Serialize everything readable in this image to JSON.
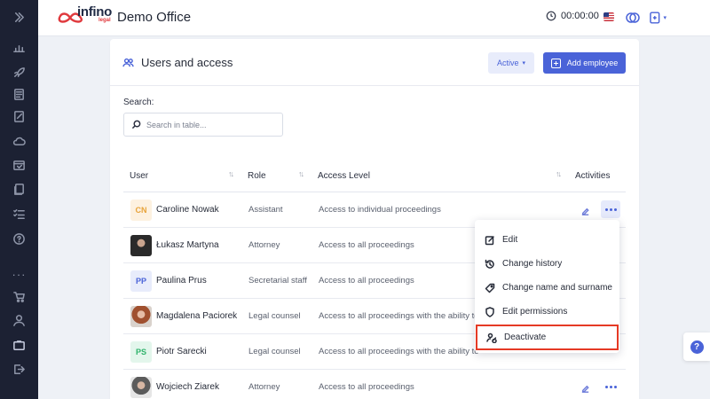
{
  "brand": {
    "logo_text": "infino",
    "logo_sub": "legal",
    "app_title": "Demo Office"
  },
  "topbar": {
    "timer": "00:00:00"
  },
  "card": {
    "title": "Users and access",
    "status_filter": "Active",
    "add_button": "Add employee",
    "search_label": "Search:",
    "search_placeholder": "Search in table..."
  },
  "table": {
    "headers": {
      "user": "User",
      "role": "Role",
      "access": "Access Level",
      "activities": "Activities"
    },
    "rows": [
      {
        "initials": "CN",
        "name": "Caroline Nowak",
        "role": "Assistant",
        "access": "Access to individual proceedings"
      },
      {
        "initials": "",
        "name": "Łukasz Martyna",
        "role": "Attorney",
        "access": "Access to all proceedings"
      },
      {
        "initials": "PP",
        "name": "Paulina Prus",
        "role": "Secretarial staff",
        "access": "Access to all proceedings"
      },
      {
        "initials": "",
        "name": "Magdalena Paciorek",
        "role": "Legal counsel",
        "access": "Access to all proceedings with the ability to"
      },
      {
        "initials": "PS",
        "name": "Piotr Sarecki",
        "role": "Legal counsel",
        "access": "Access to all proceedings with the ability to"
      },
      {
        "initials": "",
        "name": "Wojciech Ziarek",
        "role": "Attorney",
        "access": "Access to all proceedings"
      }
    ]
  },
  "menu": {
    "items": [
      {
        "label": "Edit",
        "icon": "edit-icon"
      },
      {
        "label": "Change history",
        "icon": "history-icon"
      },
      {
        "label": "Change name and surname",
        "icon": "tag-icon"
      },
      {
        "label": "Edit permissions",
        "icon": "shield-icon"
      },
      {
        "label": "Deactivate",
        "icon": "user-deactivate-icon"
      }
    ]
  },
  "help": {
    "label": "?"
  },
  "colors": {
    "accent": "#4a63d8",
    "rail": "#1c2133",
    "highlight": "#e53a25"
  }
}
